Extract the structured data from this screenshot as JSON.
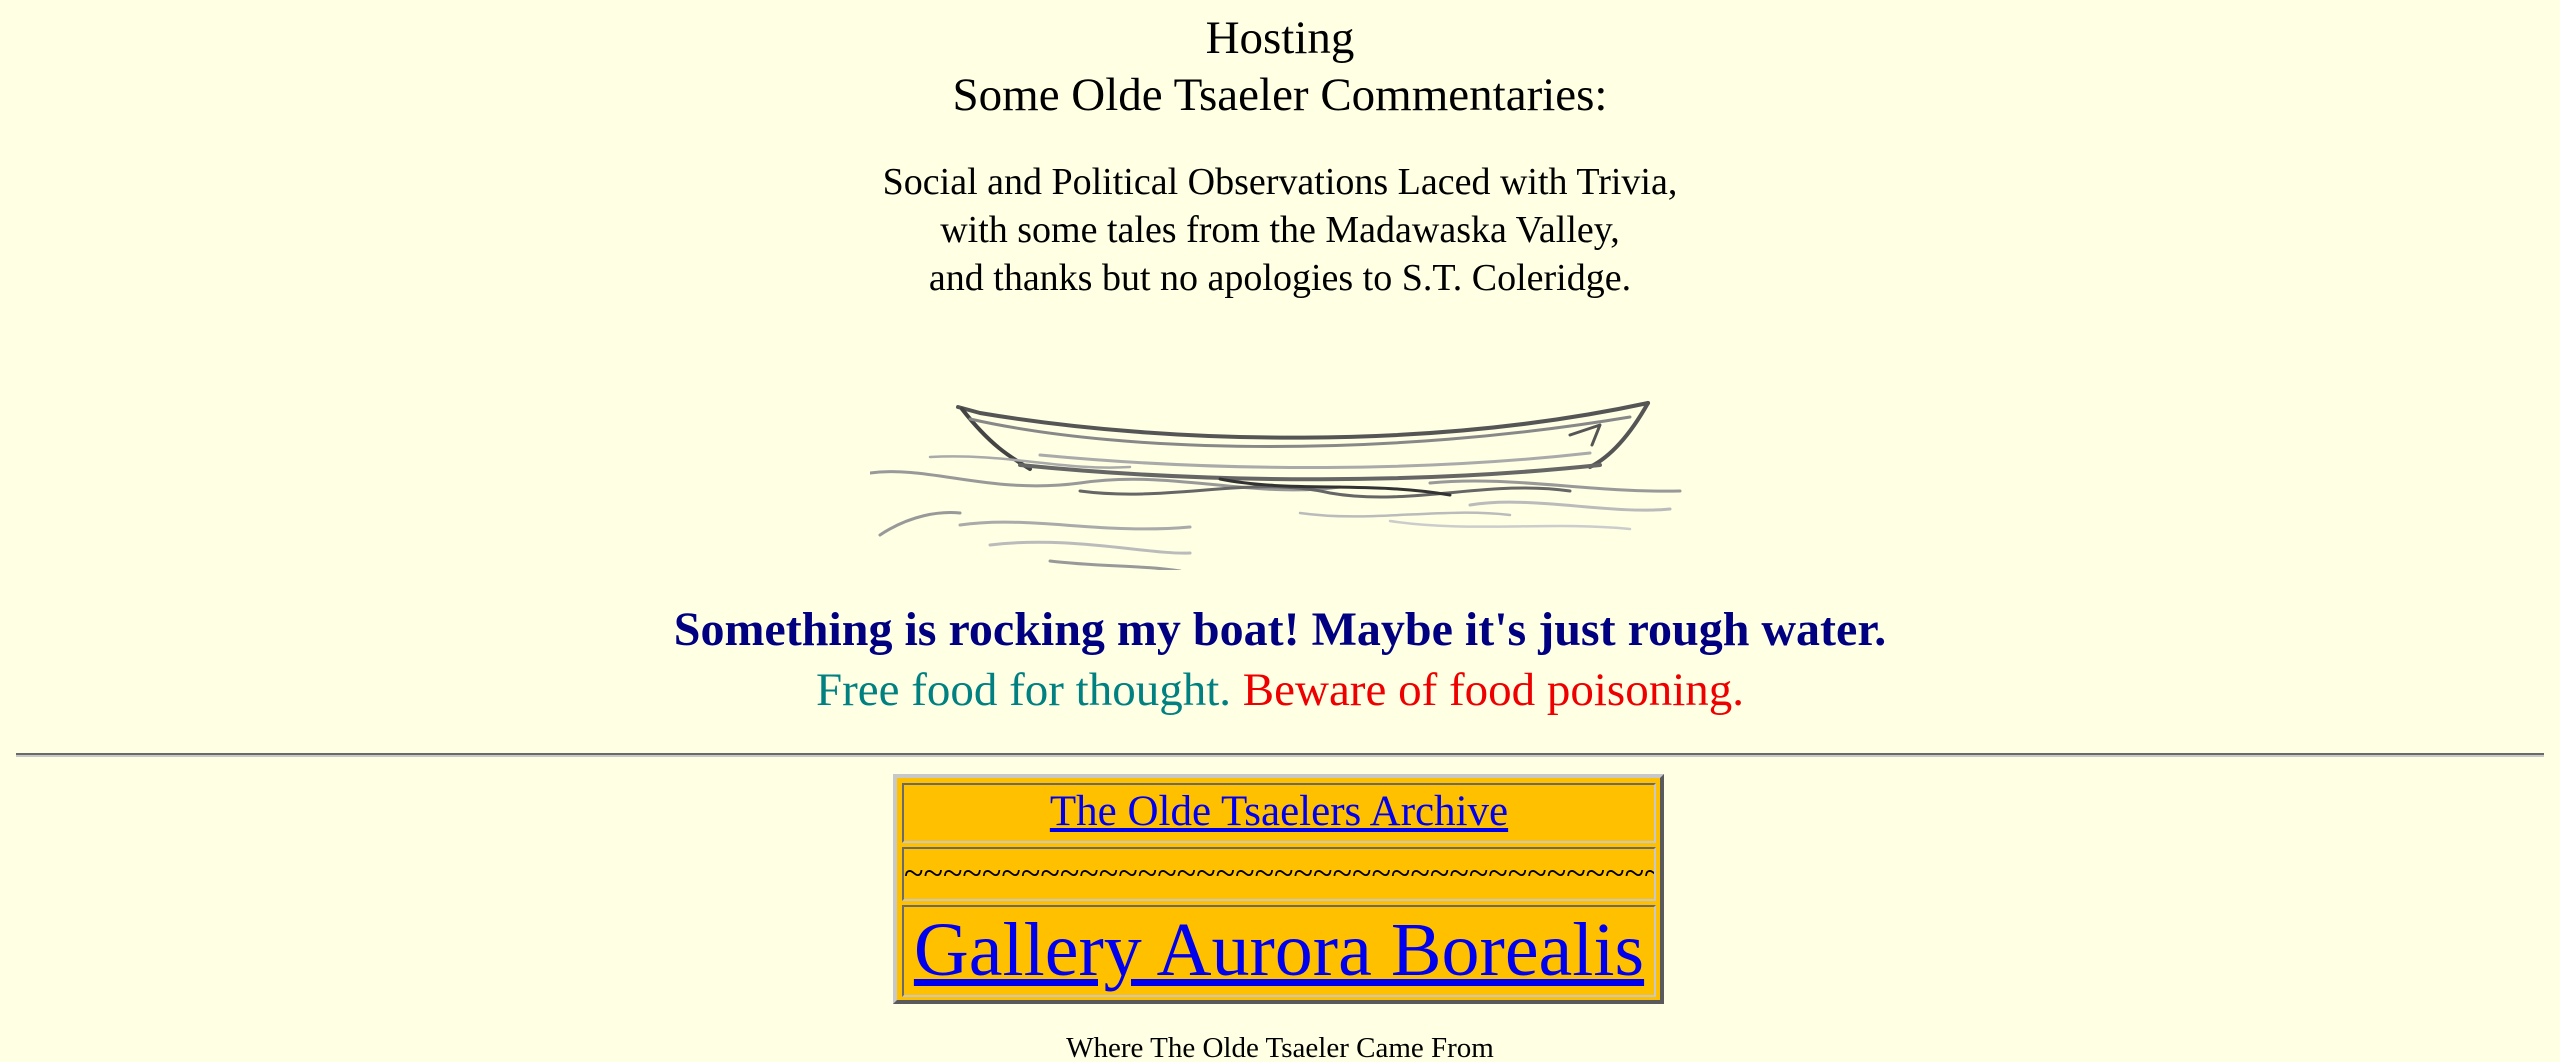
{
  "header": {
    "hosting": "Hosting",
    "title": "Some Olde Tsaeler Commentaries:"
  },
  "subtitle": {
    "line1": "Social and Political Observations Laced with Trivia,",
    "line2": "with some tales from the Madawaska Valley,",
    "line3": "and thanks but no apologies to S.T. Coleridge."
  },
  "image": {
    "icon": "rowboat-sketch-icon"
  },
  "tagline": {
    "rocking": "Something is rocking my boat! Maybe it's just rough water.",
    "free_food": "Free food for thought.",
    "beware": "Beware of food poisoning."
  },
  "nav": {
    "archive_link": "The Olde Tsaelers Archive",
    "divider": "~~~~~~~~~~~~~~~~~~~~~~~~~~~~~~~~~~~~~~~~",
    "gallery_link": "Gallery Aurora Borealis"
  },
  "footer": {
    "origin_text": "Where The Olde Tsaeler Came From"
  },
  "colors": {
    "background": "#ffffe4",
    "navy": "#000080",
    "teal": "#008080",
    "red": "#ee0000",
    "nav_bg": "#ffc000",
    "link": "#0000ee"
  }
}
